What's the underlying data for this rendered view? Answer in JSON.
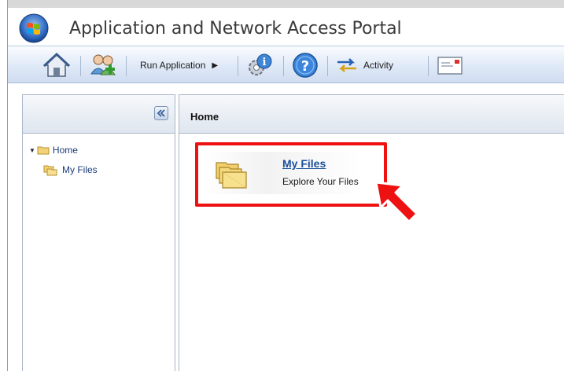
{
  "window": {
    "title": "Application and Network Access Portal"
  },
  "toolbar": {
    "home_icon": "home-icon",
    "users_icon": "add-user-icon",
    "run_application_label": "Run Application",
    "run_application_arrow": "▶",
    "properties_icon": "gear-info-icon",
    "help_icon": "help-icon",
    "activity_label": "Activity",
    "message_icon": "message-icon"
  },
  "left_panel": {
    "collapse_icon": "double-chevron-left-icon",
    "tree": [
      {
        "label": "Home",
        "expanded": true
      },
      {
        "label": "My Files"
      }
    ]
  },
  "main": {
    "title": "Home",
    "tiles": [
      {
        "label": "My Files",
        "description": "Explore Your Files"
      }
    ]
  },
  "colors": {
    "highlight": "#ee1111",
    "link": "#1a4f9c",
    "toolbar_top": "#fafcff",
    "toolbar_bottom": "#cfdcf0"
  }
}
